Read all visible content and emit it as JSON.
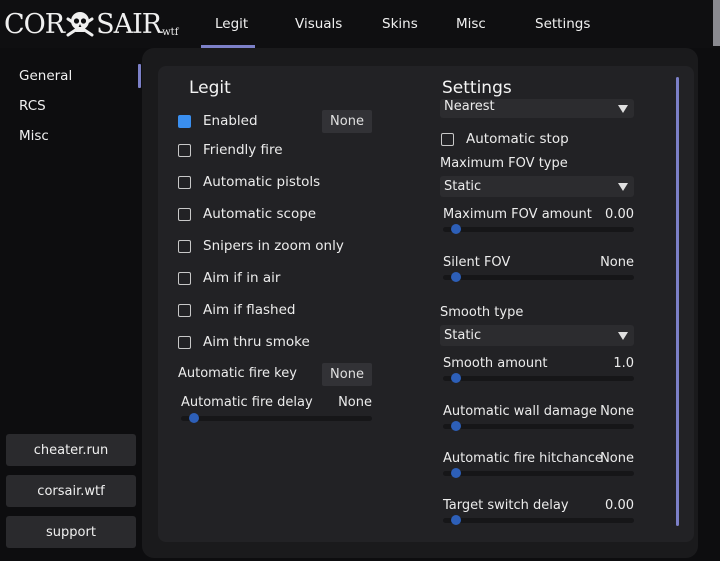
{
  "logo": {
    "left": "COR",
    "right": "SAIR",
    "tld": "wtf",
    "icon": "skull-crossbones-icon"
  },
  "tabs": [
    {
      "label": "Legit",
      "active": true
    },
    {
      "label": "Visuals"
    },
    {
      "label": "Skins"
    },
    {
      "label": "Misc"
    },
    {
      "label": "Settings"
    }
  ],
  "sidebar": {
    "items": [
      {
        "label": "General",
        "active": true
      },
      {
        "label": "RCS"
      },
      {
        "label": "Misc"
      }
    ],
    "buttons": [
      {
        "label": "cheater.run"
      },
      {
        "label": "corsair.wtf"
      },
      {
        "label": "support"
      }
    ]
  },
  "legit": {
    "title": "Legit",
    "enabled_key": "None",
    "checkboxes": [
      {
        "label": "Enabled",
        "checked": true
      },
      {
        "label": "Friendly fire",
        "checked": false
      },
      {
        "label": "Automatic pistols",
        "checked": false
      },
      {
        "label": "Automatic scope",
        "checked": false
      },
      {
        "label": "Snipers in zoom only",
        "checked": false
      },
      {
        "label": "Aim if in air",
        "checked": false
      },
      {
        "label": "Aim if flashed",
        "checked": false
      },
      {
        "label": "Aim thru smoke",
        "checked": false
      }
    ],
    "auto_fire_key": {
      "label": "Automatic fire key",
      "value": "None"
    },
    "auto_fire_delay": {
      "label": "Automatic fire delay",
      "value": "None",
      "fraction": 0.0
    }
  },
  "settings": {
    "title": "Settings",
    "hitbox_select": "Nearest",
    "automatic_stop": {
      "label": "Automatic stop",
      "checked": false
    },
    "fov_type": {
      "label": "Maximum FOV type",
      "value": "Static"
    },
    "fov_amount": {
      "label": "Maximum FOV amount",
      "value": "0.00",
      "fraction": 0.0
    },
    "silent_fov": {
      "label": "Silent FOV",
      "value": "None",
      "fraction": 0.0
    },
    "smooth_type": {
      "label": "Smooth type",
      "value": "Static"
    },
    "smooth_amount": {
      "label": "Smooth amount",
      "value": "1.0",
      "fraction": 0.0
    },
    "wall_damage": {
      "label": "Automatic wall damage",
      "value": "None",
      "fraction": 0.0
    },
    "fire_hitchance": {
      "label": "Automatic fire hitchance",
      "value": "None",
      "fraction": 0.0
    },
    "switch_delay": {
      "label": "Target switch delay",
      "value": "0.00",
      "fraction": 0.0
    }
  },
  "colors": {
    "accent": "#7c80c8",
    "checkbox_on": "#3a8ff0",
    "slider_thumb": "#2d5fb8"
  }
}
